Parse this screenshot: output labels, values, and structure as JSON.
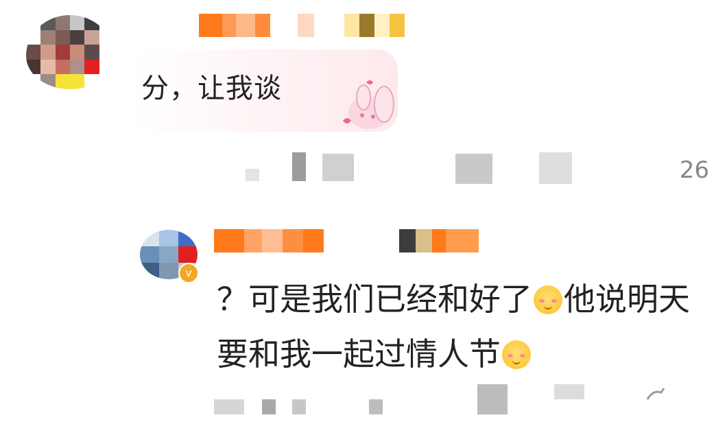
{
  "comments": [
    {
      "text": "分，让我谈",
      "count": "26",
      "sticker": "bunny-sticker"
    },
    {
      "text_part1": "？可是我们已经和好了",
      "emoji1": "blush-emoji",
      "text_part2": "他说明天要和我一起过情人节",
      "emoji2": "blush-emoji",
      "verified_icon": "v"
    }
  ],
  "colors": {
    "accent_orange": "#ff7a1a",
    "verify_badge": "#f5a623",
    "text": "#222222",
    "muted": "#888888"
  }
}
